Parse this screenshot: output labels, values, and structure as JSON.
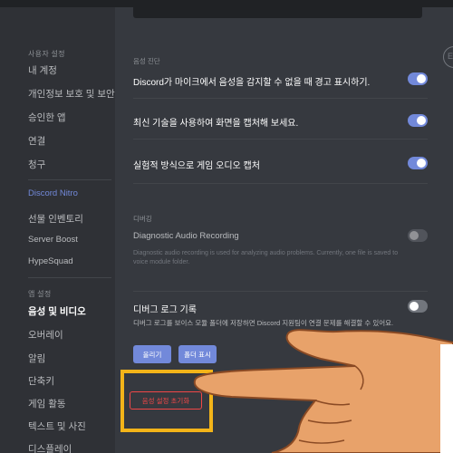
{
  "sidebar": {
    "user_settings_header": "사용자 설정",
    "items": [
      {
        "label": "내 계정"
      },
      {
        "label": "개인정보 보호 및 보안"
      },
      {
        "label": "승인한 앱"
      },
      {
        "label": "연결"
      },
      {
        "label": "청구"
      }
    ],
    "nitro_items": [
      {
        "label": "Discord Nitro"
      },
      {
        "label": "선물 인벤토리"
      },
      {
        "label": "Server Boost"
      },
      {
        "label": "HypeSquad"
      }
    ],
    "app_settings_header": "앱 설정",
    "app_items": [
      {
        "label": "음성 및 비디오"
      },
      {
        "label": "오버레이"
      },
      {
        "label": "알림"
      },
      {
        "label": "단축키"
      },
      {
        "label": "게임 활동"
      },
      {
        "label": "텍스트 및 사진"
      },
      {
        "label": "디스플레이"
      }
    ]
  },
  "voice_diagnostics": {
    "header": "음성 진단",
    "rows": [
      {
        "label": "Discord가 마이크에서 음성을 감지할 수 없을 때 경고 표시하기.",
        "enabled": true
      },
      {
        "label": "최신 기술을 사용하여 화면을 캡처해 보세요.",
        "enabled": true
      },
      {
        "label": "실험적 방식으로 게임 오디오 캡처",
        "enabled": true
      }
    ]
  },
  "debug": {
    "header": "디버깅",
    "diagnostic_title": "Diagnostic Audio Recording",
    "diagnostic_desc": "Diagnostic audio recording is used for analyzing audio problems. Currently, one file is saved to voice module folder.",
    "diagnostic_enabled": false,
    "log_title": "디버그 로그 기록",
    "log_desc": "디버그 로그를 보이스 모듈 폴더에 저장하면 Discord 지원팀이 연결 문제를 해결할 수 있어요.",
    "log_enabled": false,
    "upload_label": "올리기",
    "show_folder_label": "폴더 표시"
  },
  "reset_label": "음성 설정 초기화",
  "esc_label": "ES",
  "colors": {
    "accent": "#7289da",
    "danger": "#f04747",
    "highlight": "#f3b419",
    "background": "#36393f",
    "sidebar": "#2f3136"
  }
}
